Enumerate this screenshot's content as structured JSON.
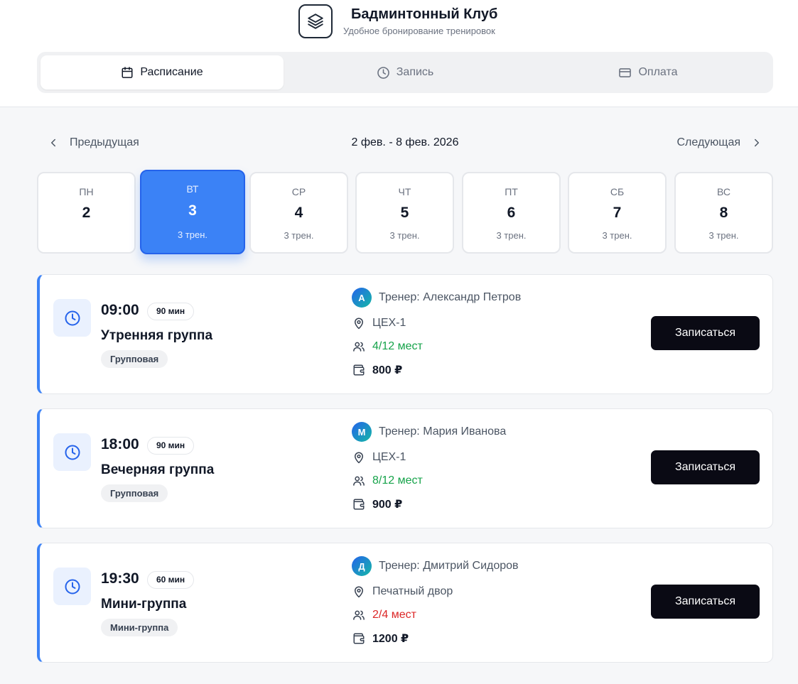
{
  "brand": {
    "title": "Бадминтонный Клуб",
    "subtitle": "Удобное бронирование тренировок",
    "logo_icon": "layers-icon"
  },
  "tabs": [
    {
      "label": "Расписание",
      "icon": "calendar-icon",
      "active": true
    },
    {
      "label": "Запись",
      "icon": "clock-icon",
      "active": false
    },
    {
      "label": "Оплата",
      "icon": "credit-card-icon",
      "active": false
    }
  ],
  "week": {
    "prev_label": "Предыдущая",
    "next_label": "Следующая",
    "range": "2 фев. - 8 фев. 2026"
  },
  "days": [
    {
      "name": "ПН",
      "num": "2",
      "count": "",
      "active": false
    },
    {
      "name": "ВТ",
      "num": "3",
      "count": "3 трен.",
      "active": true
    },
    {
      "name": "СР",
      "num": "4",
      "count": "3 трен.",
      "active": false
    },
    {
      "name": "ЧТ",
      "num": "5",
      "count": "3 трен.",
      "active": false
    },
    {
      "name": "ПТ",
      "num": "6",
      "count": "3 трен.",
      "active": false
    },
    {
      "name": "СБ",
      "num": "7",
      "count": "3 трен.",
      "active": false
    },
    {
      "name": "ВС",
      "num": "8",
      "count": "3 трен.",
      "active": false
    }
  ],
  "sessions": [
    {
      "time": "09:00",
      "duration": "90 мин",
      "name": "Утренняя группа",
      "type": "Групповая",
      "trainer_initial": "А",
      "trainer": "Тренер: Александр Петров",
      "location": "ЦЕХ-1",
      "seats": "4/12 мест",
      "seats_status": "available",
      "price": "800 ₽",
      "button": "Записаться"
    },
    {
      "time": "18:00",
      "duration": "90 мин",
      "name": "Вечерняя группа",
      "type": "Групповая",
      "trainer_initial": "М",
      "trainer": "Тренер: Мария Иванова",
      "location": "ЦЕХ-1",
      "seats": "8/12 мест",
      "seats_status": "available",
      "price": "900 ₽",
      "button": "Записаться"
    },
    {
      "time": "19:30",
      "duration": "60 мин",
      "name": "Мини-группа",
      "type": "Мини-группа",
      "trainer_initial": "Д",
      "trainer": "Тренер: Дмитрий Сидоров",
      "location": "Печатный двор",
      "seats": "2/4 мест",
      "seats_status": "low",
      "price": "1200 ₽",
      "button": "Записаться"
    }
  ],
  "colors": {
    "accent": "#3b82f6",
    "seats_available": "#16a34a",
    "seats_low": "#dc2626",
    "button_bg": "#0a0a14"
  }
}
